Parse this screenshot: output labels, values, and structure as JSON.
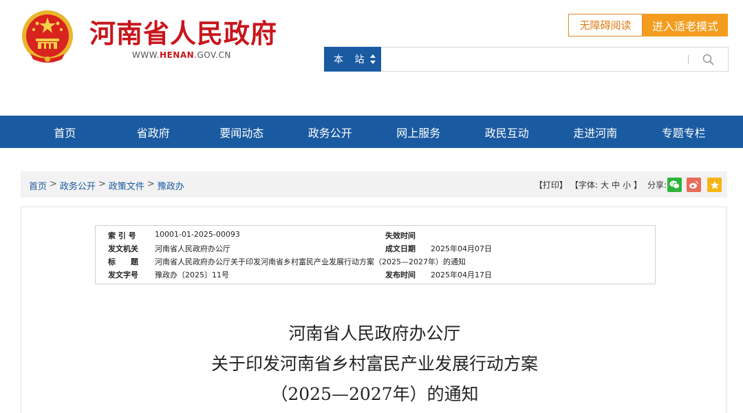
{
  "header": {
    "site_title": "河南省人民政府",
    "site_url_prefix": "WWW.",
    "site_url_brand": "HENAN",
    "site_url_suffix": ".GOV.CN",
    "accessible_label": "无障碍阅读",
    "elder_label": "进入适老模式",
    "search": {
      "scope_label": "本 站",
      "placeholder": ""
    }
  },
  "nav": {
    "items": [
      "首页",
      "省政府",
      "要闻动态",
      "政务公开",
      "网上服务",
      "政民互动",
      "走进河南",
      "专题专栏"
    ]
  },
  "breadcrumb": {
    "items": [
      "首页",
      "政务公开",
      "政策文件",
      "豫政办"
    ],
    "separator": ">"
  },
  "tools": {
    "print": "【打印】",
    "font_label": "【字体:",
    "font_large": "大",
    "font_medium": "中",
    "font_small": "小",
    "font_close": "】",
    "share_label": "分享:"
  },
  "meta": {
    "index_label": "索 引 号",
    "index_value": "10001-01-2025-00093",
    "expire_label": "失效时间",
    "expire_value": "",
    "issuer_label": "发文机关",
    "issuer_value": "河南省人民政府办公厅",
    "created_label": "成文日期",
    "created_value": "2025年04月07日",
    "title_label": "标　　题",
    "title_value": "河南省人民政府办公厅关于印发河南省乡村富民产业发展行动方案（2025—2027年）的通知",
    "docno_label": "发文字号",
    "docno_value": "豫政办〔2025〕11号",
    "published_label": "发布时间",
    "published_value": "2025年04月17日"
  },
  "document": {
    "title_line1": "河南省人民政府办公厅",
    "title_line2": "关于印发河南省乡村富民产业发展行动方案",
    "title_line3": "（2025—2027年）的通知"
  },
  "colors": {
    "brand_red": "#c8161d",
    "nav_blue": "#1a5aa1",
    "accent_orange": "#f39c1e"
  }
}
